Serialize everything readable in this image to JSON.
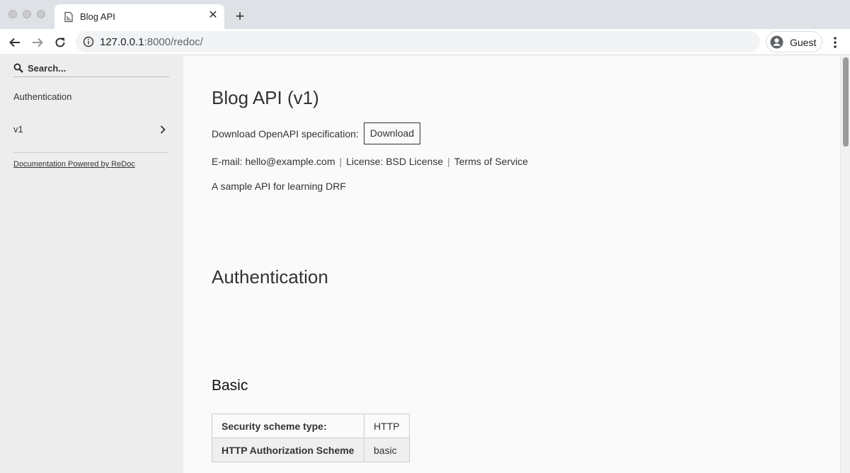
{
  "browser": {
    "tab_title": "Blog API",
    "url_host": "127.0.0.1",
    "url_rest": ":8000/redoc/",
    "profile_label": "Guest"
  },
  "sidebar": {
    "search_placeholder": "Search...",
    "items": [
      {
        "label": "Authentication"
      },
      {
        "label": "v1"
      }
    ],
    "powered_by": "Documentation Powered by ReDoc"
  },
  "main": {
    "title": "Blog API (v1)",
    "download_label": "Download OpenAPI specification:",
    "download_button": "Download",
    "email_label": "E-mail:",
    "email_value": "hello@example.com",
    "license_label": "License:",
    "license_value": "BSD License",
    "terms_label": "Terms of Service",
    "separator": "|",
    "description": "A sample API for learning DRF",
    "auth_heading": "Authentication",
    "basic_heading": "Basic",
    "table": [
      {
        "key": "Security scheme type:",
        "value": "HTTP"
      },
      {
        "key": "HTTP Authorization Scheme",
        "value": "basic"
      }
    ]
  },
  "colors": {
    "sidebar_bg": "#ededed",
    "page_bg": "#fafafa",
    "tabstrip_bg": "#dee1e6"
  }
}
